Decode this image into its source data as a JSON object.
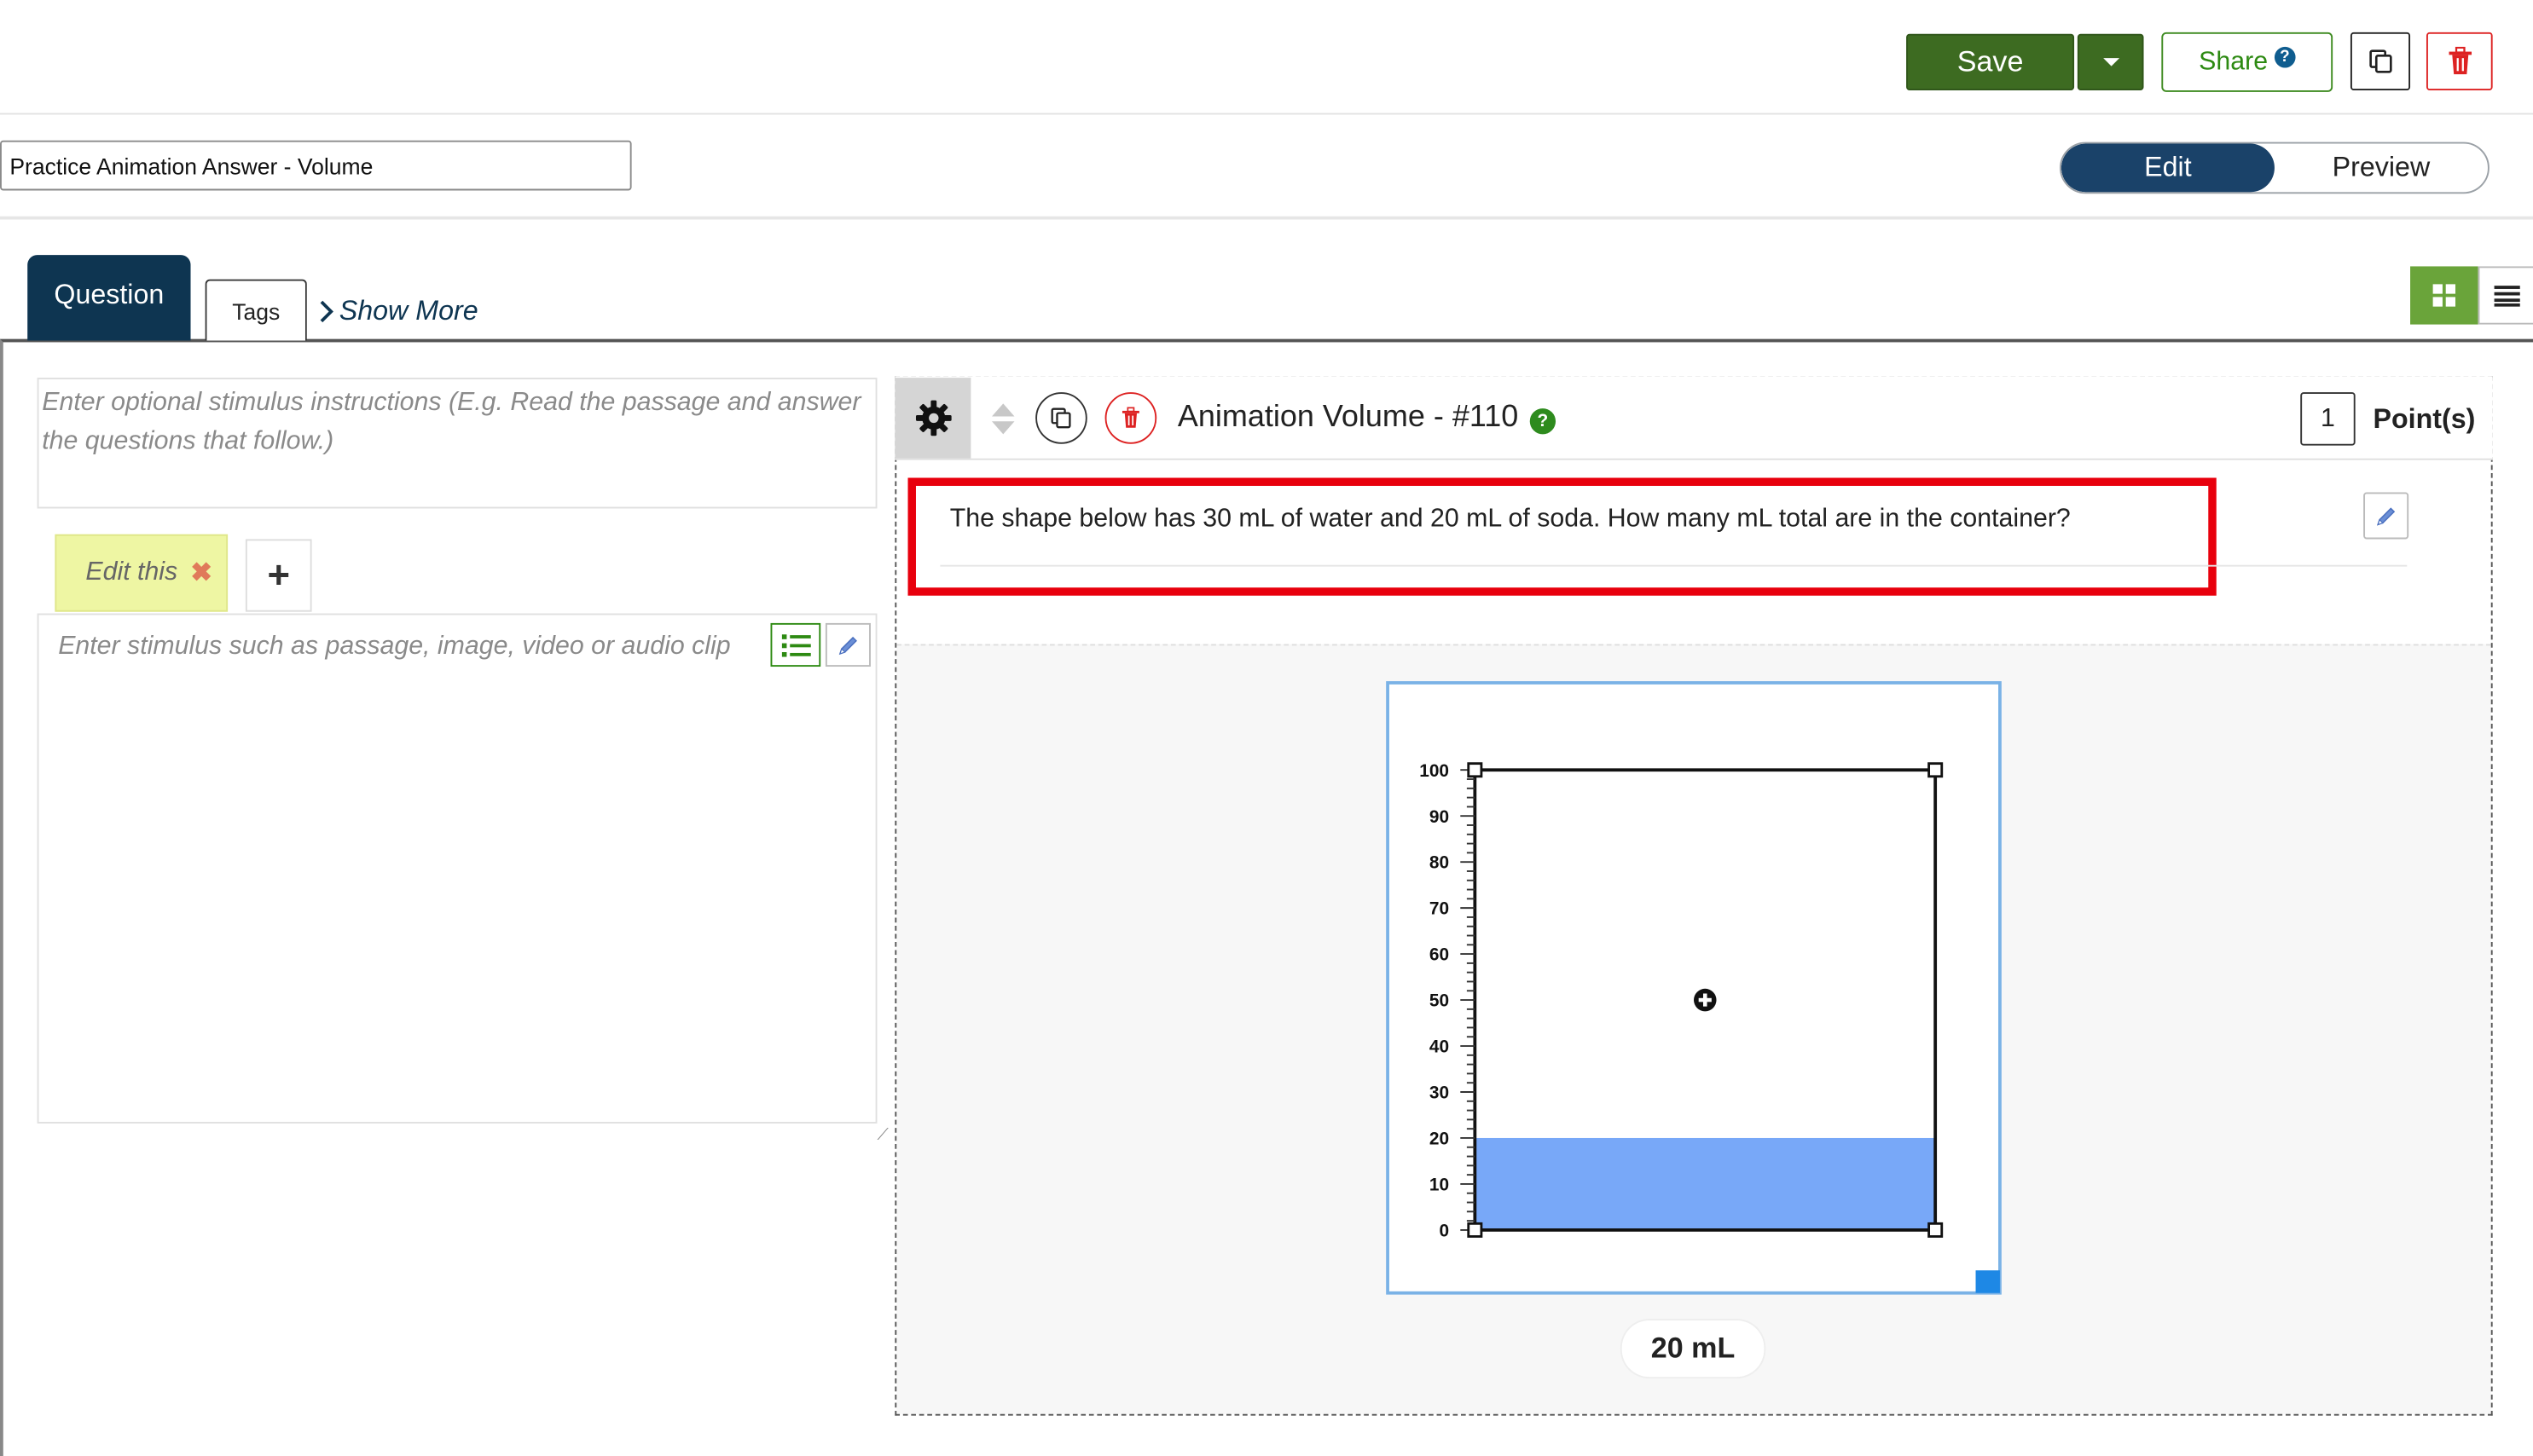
{
  "toolbar": {
    "save_label": "Save",
    "share_label": "Share",
    "share_help_icon": "?",
    "copy_icon": "copy-icon",
    "delete_icon": "trash-icon"
  },
  "title": {
    "value": "Practice Animation Answer - Volume"
  },
  "mode": {
    "edit_label": "Edit",
    "preview_label": "Preview",
    "active": "Edit"
  },
  "tabs": {
    "question_label": "Question",
    "tags_label": "Tags",
    "show_more_label": "Show More"
  },
  "stimulus": {
    "instructions_placeholder": "Enter optional stimulus instructions (E.g. Read the passage and answer the questions that follow.)",
    "tab_label": "Edit this",
    "tab_close": "✖",
    "add_label": "+",
    "body_placeholder": "Enter stimulus such as passage, image, video or audio clip"
  },
  "question": {
    "title": "Animation Volume - #110",
    "help_icon": "?",
    "points_value": "1",
    "points_label": "Point(s)",
    "text": "The shape below has 30 mL of water and 20 mL of soda. How many mL total are in the container?"
  },
  "animation": {
    "scale_labels": [
      "100",
      "90",
      "80",
      "70",
      "60",
      "50",
      "40",
      "30",
      "20",
      "10",
      "0"
    ],
    "scale_max": 100,
    "fill_level": 20,
    "fill_color": "#78a8f8",
    "volume_label": "20 mL"
  },
  "colors": {
    "save_green": "#3d6b21",
    "edit_navy": "#1a4269",
    "tab_navy": "#0e3551",
    "highlight_red": "#e8000d",
    "tab_yellow": "#eef6a3",
    "grid_view_green": "#6aa43a"
  }
}
